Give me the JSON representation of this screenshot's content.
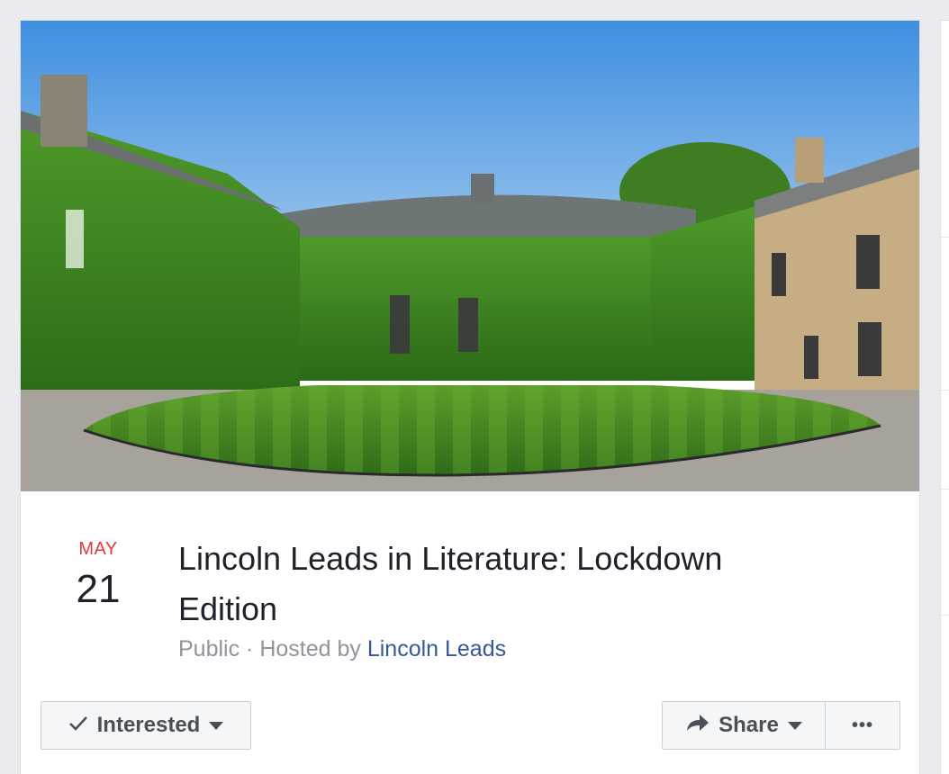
{
  "event": {
    "cover_image": "college-quad-photo",
    "date": {
      "month": "MAY",
      "day": "21"
    },
    "title": "Lincoln Leads in Literature: Lockdown Edition",
    "privacy": "Public",
    "separator": " · ",
    "hosted_by_prefix": "Hosted by ",
    "host": "Lincoln Leads"
  },
  "actions": {
    "interested_label": "Interested",
    "interested_icon": "checkmark-icon",
    "share_label": "Share",
    "share_icon": "share-arrow-icon",
    "more_label": "•••"
  },
  "colors": {
    "month": "#e0393e",
    "host_link": "#365899",
    "meta": "#90949c"
  }
}
